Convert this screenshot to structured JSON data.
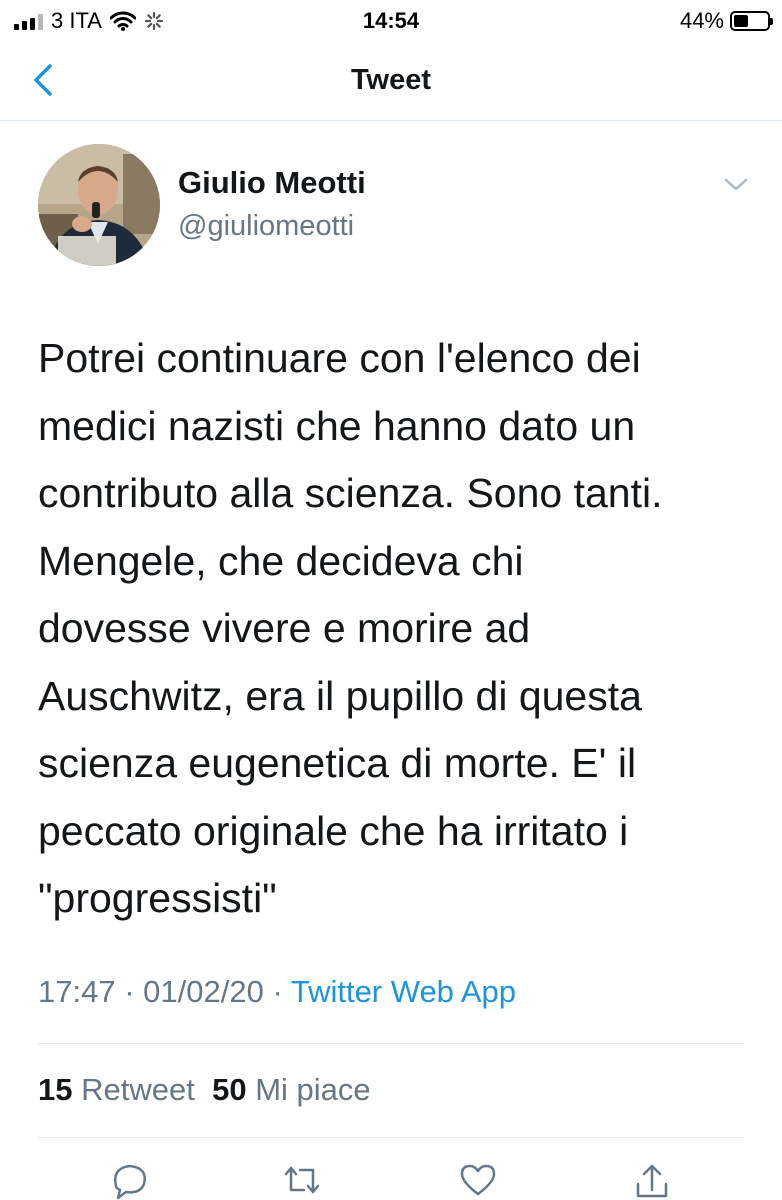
{
  "status_bar": {
    "carrier": "3 ITA",
    "time": "14:54",
    "battery": "44%",
    "battery_level": 0.44
  },
  "nav": {
    "title": "Tweet",
    "back_icon": "chevron-left-icon"
  },
  "tweet": {
    "author": {
      "name": "Giulio Meotti",
      "handle": "@giuliomeotti"
    },
    "text": "Potrei continuare con l'elenco dei\nmedici nazisti che hanno dato un\ncontributo alla scienza. Sono tanti.\nMengele, che decideva chi\ndovesse vivere e morire ad\nAuschwitz, era il pupillo di questa\nscienza eugenetica di morte. E' il\npeccato originale che ha irritato i\n\"progressisti\"",
    "time": "17:47",
    "date": "01/02/20",
    "separator": "·",
    "source": "Twitter Web App",
    "retweet_count": "15",
    "retweet_label": "Retweet",
    "like_count": "50",
    "like_label": "Mi piace"
  },
  "actions": [
    "reply-icon",
    "retweet-icon",
    "like-icon",
    "share-icon"
  ],
  "colors": {
    "accent": "#1b95e0",
    "text": "#14171a",
    "secondary": "#657786",
    "divider": "#e1e8ed"
  }
}
